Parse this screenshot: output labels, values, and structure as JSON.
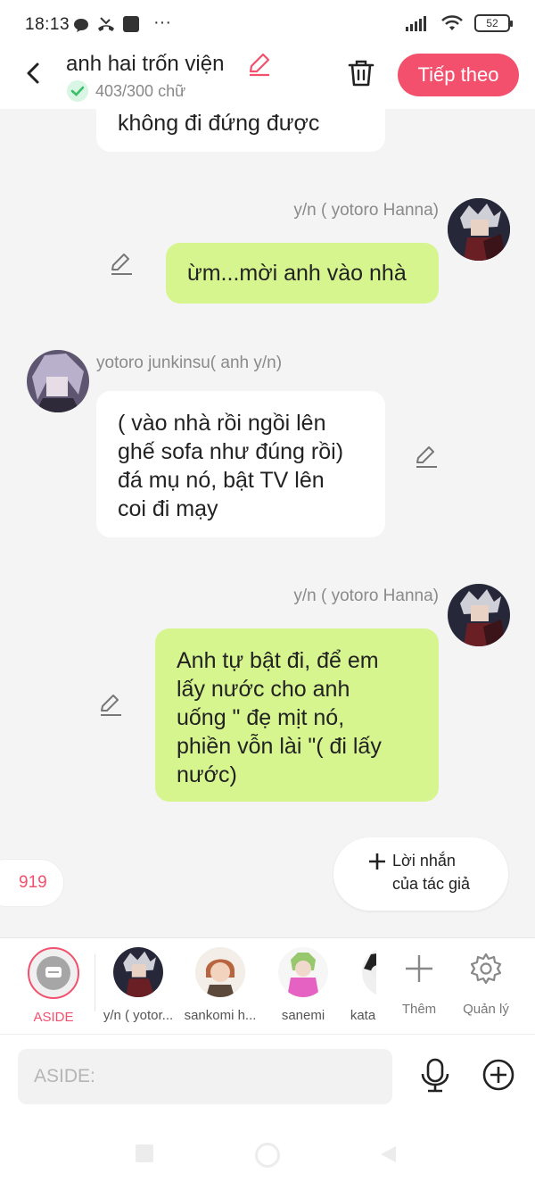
{
  "status_bar": {
    "time": "18:13",
    "more": "···",
    "battery": "52"
  },
  "header": {
    "title": "anh hai trốn viện",
    "word_count": "403/300 chữ",
    "next_button": "Tiếp theo"
  },
  "messages": [
    {
      "side": "left",
      "text_lines": [
        "không đi đứng được"
      ]
    },
    {
      "side": "right",
      "sender": "y/n ( yotoro Hanna)",
      "text_lines": [
        "ừm...mời anh vào nhà"
      ]
    },
    {
      "side": "left",
      "sender": "yotoro junkinsu( anh y/n)",
      "text_lines": [
        "( vào nhà rồi ngồi lên",
        "ghế sofa như đúng rồi)",
        "đá mụ nó, bật TV lên",
        "coi đi mạy"
      ]
    },
    {
      "side": "right",
      "sender": "y/n ( yotoro Hanna)",
      "text_lines": [
        "Anh tự bật đi, để em",
        "lấy nước cho anh",
        "uống \" đẹ mịt nó,",
        "phiền vỗn lài \"( đi lấy",
        "nước)"
      ]
    }
  ],
  "message_count": "919",
  "author_note": {
    "line1": "Lời nhắn",
    "line2": "của tác giả"
  },
  "characters": [
    {
      "label": "ASIDE",
      "active": true
    },
    {
      "label": "y/n ( yotor..."
    },
    {
      "label": "sankomi h..."
    },
    {
      "label": "sanemi"
    },
    {
      "label": "kata"
    }
  ],
  "tools": {
    "add_label": "Thêm",
    "manage_label": "Quản lý"
  },
  "input": {
    "placeholder": "ASIDE:"
  },
  "colors": {
    "accent": "#f2506d",
    "bubble_right": "#d6f58f",
    "bubble_left": "#ffffff",
    "background": "#f4f4f4"
  }
}
